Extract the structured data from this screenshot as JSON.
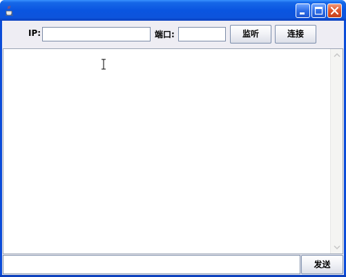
{
  "window": {
    "icon": "java-cup-icon",
    "buttons": [
      "minimize",
      "maximize",
      "close"
    ]
  },
  "toolbar": {
    "ip_label": "IP:",
    "ip_value": "",
    "port_label": "端口:",
    "port_value": "",
    "listen_label": "监听",
    "connect_label": "连接"
  },
  "chat": {
    "content": ""
  },
  "footer": {
    "message_value": "",
    "send_label": "发送"
  }
}
